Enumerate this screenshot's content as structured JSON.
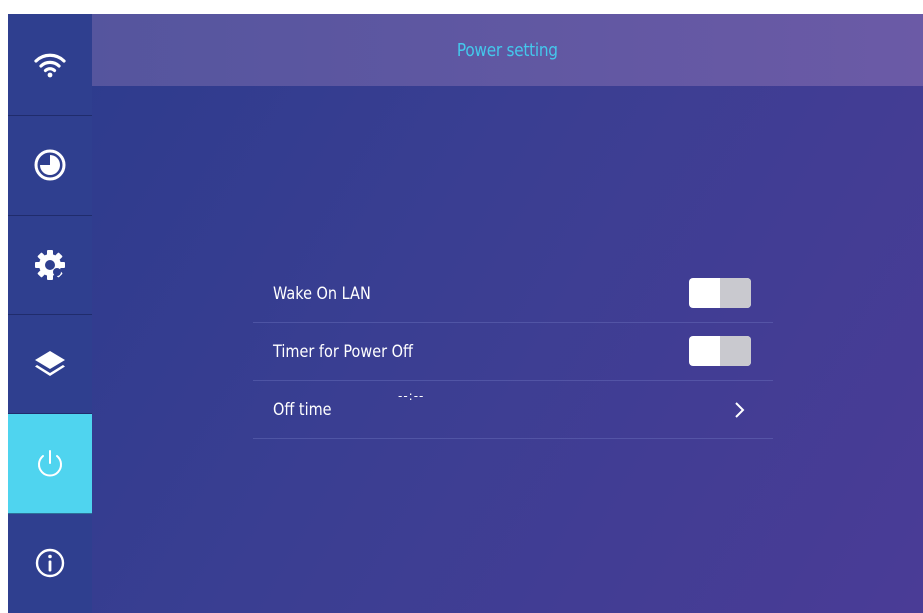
{
  "header": {
    "title": "Power setting"
  },
  "sidebar": {
    "items": [
      {
        "icon": "wifi-icon",
        "active": false
      },
      {
        "icon": "clock-icon",
        "active": false
      },
      {
        "icon": "gear-icon",
        "active": false
      },
      {
        "icon": "layers-icon",
        "active": false
      },
      {
        "icon": "power-icon",
        "active": true
      },
      {
        "icon": "info-icon",
        "active": false
      }
    ]
  },
  "settings": {
    "wake_on_lan": {
      "label": "Wake On LAN",
      "enabled": false
    },
    "timer_power_off": {
      "label": "Timer for Power Off",
      "enabled": false
    },
    "off_time": {
      "label": "Off time",
      "value": "--:--"
    }
  },
  "colors": {
    "accent": "#4fd4ef",
    "title": "#44c8ec",
    "sidebar": "#2f3f8f"
  }
}
